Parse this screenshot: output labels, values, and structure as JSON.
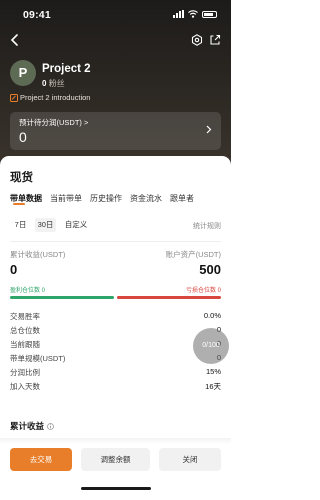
{
  "status": {
    "time": "09:41"
  },
  "profile": {
    "avatar_letter": "P",
    "name": "Project 2",
    "fans_count": "0",
    "fans_label": "粉丝",
    "intro": "Project 2 introduction"
  },
  "share_card": {
    "label": "预计待分润(USDT) >",
    "value": "0"
  },
  "section": {
    "title": "现货"
  },
  "tabs": [
    "带单数据",
    "当前带单",
    "历史操作",
    "资金流水",
    "跟单者"
  ],
  "periods": [
    "7日",
    "30日",
    "自定义"
  ],
  "active_period": "30日",
  "stats_rule": "统计规则",
  "cumulative_profit": {
    "label": "累计收益(USDT)",
    "value": "0"
  },
  "account_assets": {
    "label": "账户资产(USDT)",
    "value": "500"
  },
  "positions": {
    "profit_label": "盈利仓位数 0",
    "loss_label": "亏损仓位数 0"
  },
  "stats": [
    {
      "label": "交易胜率",
      "value": "0.0%"
    },
    {
      "label": "总仓位数",
      "value": "0"
    },
    {
      "label": "当前跟随",
      "value": "0"
    },
    {
      "label": "带单规模(USDT)",
      "value": "0"
    },
    {
      "label": "分润比例",
      "value": "15%"
    },
    {
      "label": "加入天数",
      "value": "16天"
    }
  ],
  "follow_counter": "0/100",
  "cumulative_section": {
    "title": "累计收益"
  },
  "buttons": {
    "trade": "去交易",
    "adjust": "调整余额",
    "close": "关闭"
  },
  "colors": {
    "accent": "#e87e2a",
    "profit": "#2ea56b",
    "loss": "#d8473e"
  }
}
